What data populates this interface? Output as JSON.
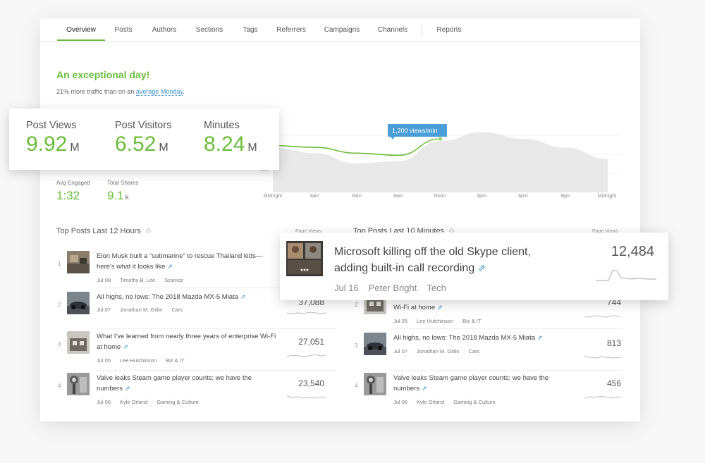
{
  "nav": {
    "tabs": [
      "Overview",
      "Posts",
      "Authors",
      "Sections",
      "Tags",
      "Referrers",
      "Campaigns",
      "Channels",
      "Reports"
    ],
    "active": "Overview"
  },
  "headline": "An exceptional day!",
  "subline": {
    "prefix": "21% more traffic than on an ",
    "link": "average Monday",
    "suffix": "."
  },
  "stats": [
    {
      "label": "Post Views",
      "value": "9.92",
      "unit": "M"
    },
    {
      "label": "Post Visitors",
      "value": "6.52",
      "unit": "M"
    },
    {
      "label": "Minutes",
      "value": "8.24",
      "unit": "M"
    }
  ],
  "small_stats": [
    {
      "label": "Avg Engaged",
      "value": "1:32",
      "unit": ""
    },
    {
      "label": "Total Shares",
      "value": "9.1",
      "unit": "k"
    }
  ],
  "chart_data": {
    "type": "area",
    "x": [
      "Midnight",
      "3am",
      "6am",
      "9am",
      "Noon",
      "3pm",
      "6pm",
      "9pm",
      "Midnight"
    ],
    "series": [
      {
        "name": "",
        "kind": "average",
        "values": [
          1000,
          880,
          650,
          700,
          1150,
          1350,
          1200,
          1000,
          750
        ]
      },
      {
        "name": "",
        "kind": "today",
        "values": [
          1050,
          1010,
          880,
          830,
          1200
        ]
      }
    ],
    "y_visible_tick": "500",
    "tooltip": "1,200 views/min",
    "colors": {
      "today": "#6cbc3c",
      "average": "#e5e5e5",
      "tooltip": "#4a9fd8"
    }
  },
  "left_section": {
    "title": "Top Posts Last 12 Hours",
    "col_header": "Page Views",
    "posts": [
      {
        "rank": "1",
        "title": "Elon Musk built a “submarine” to rescue Thailand kids—here's what it looks like",
        "date": "Jul 08",
        "author": "Timothy B. Lee",
        "section": "Science",
        "views": ""
      },
      {
        "rank": "2",
        "title": "All highs, no lows: The 2018 Mazda MX-5 Miata",
        "date": "Jul 07",
        "author": "Jonathan M. Gitlin",
        "section": "Cars",
        "views": "37,088"
      },
      {
        "rank": "3",
        "title": "What I've learned from nearly three years of enterprise Wi-Fi at home",
        "date": "Jul 05",
        "author": "Lee Hutchinson",
        "section": "Biz & IT",
        "views": "27,051"
      },
      {
        "rank": "4",
        "title": "Valve leaks Steam game player counts; we have the numbers",
        "date": "Jul 06",
        "author": "Kyle Orland",
        "section": "Gaming & Culture",
        "views": "23,540"
      }
    ]
  },
  "right_section": {
    "title": "Top Posts Last 10 Minutes",
    "col_header": "Page Views",
    "posts": [
      {
        "rank": "2",
        "title": "What I've learned from nearly three years of enterprise Wi-Fi at home",
        "date": "Jul 05",
        "author": "Lee Hutchinson",
        "section": "Biz & IT",
        "views": "744"
      },
      {
        "rank": "3",
        "title": "All highs, no lows: The 2018 Mazda MX-5 Miata",
        "date": "Jul 07",
        "author": "Jonathan M. Gitlin",
        "section": "Cars",
        "views": "813"
      },
      {
        "rank": "4",
        "title": "Valve leaks Steam game player counts; we have the numbers",
        "date": "Jul 06",
        "author": "Kyle Orland",
        "section": "Gaming & Culture",
        "views": "456"
      }
    ]
  },
  "featured_post": {
    "title": "Microsoft killing off the old Skype client, adding built-in call recording",
    "date": "Jul 16",
    "author": "Peter Bright",
    "section": "Tech",
    "views": "12,484"
  }
}
